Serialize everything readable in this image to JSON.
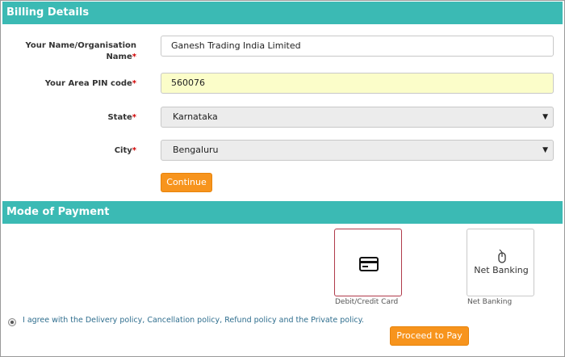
{
  "billing": {
    "title": "Billing Details",
    "name_label": "Your Name/Organisation Name",
    "name_value": "Ganesh Trading India Limited",
    "pin_label": "Your Area PIN code",
    "pin_value": "560076",
    "state_label": "State",
    "state_value": "Karnataka",
    "city_label": "City",
    "city_value": "Bengaluru",
    "required_mark": "*",
    "continue_label": "Continue"
  },
  "payment": {
    "title": "Mode of Payment",
    "options": [
      {
        "caption": "Debit/Credit Card",
        "icon": "credit-card-icon",
        "selected": true
      },
      {
        "caption": "Net Banking",
        "icon": "mouse-icon",
        "box_text": "Net Banking",
        "selected": false
      }
    ],
    "agree_text": "I agree with the Delivery policy, Cancellation policy, Refund policy and the Private policy.",
    "proceed_label": "Proceed to Pay"
  },
  "colors": {
    "header": "#3bbab4",
    "button": "#f7941d",
    "selected_border": "#b03a4a",
    "pin_field_bg": "#fbfdc9"
  },
  "icons": {
    "dropdown": "▼"
  }
}
